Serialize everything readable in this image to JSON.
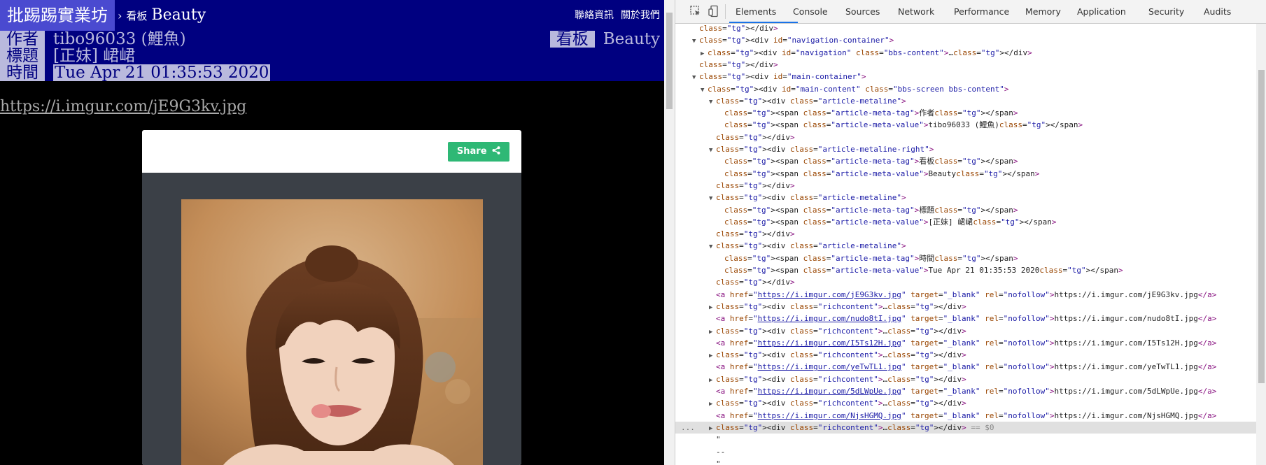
{
  "topbar": {
    "brand": "批踢踢實業坊",
    "separator": "›",
    "board_prefix": "看板",
    "board_name": "Beauty",
    "links": [
      "聯絡資訊",
      "關於我們"
    ]
  },
  "meta": {
    "author_tag": "作者",
    "author_value": "tibo96033 (鯉魚)",
    "board_tag": "看板",
    "board_value": "Beauty",
    "title_tag": "標題",
    "title_value": "[正妹] 峮峮",
    "time_tag": "時間",
    "time_value": "Tue Apr 21 01:35:53 2020"
  },
  "article": {
    "image_link": "https://i.imgur.com/jE9G3kv.jpg",
    "share_label": "Share"
  },
  "devtools": {
    "tabs": [
      "Elements",
      "Console",
      "Sources",
      "Network",
      "Performance",
      "Memory",
      "Application",
      "Security",
      "Audits"
    ],
    "active_tab": "Elements",
    "tree": [
      {
        "indent": 1,
        "tri": "",
        "html": "</div>"
      },
      {
        "indent": 1,
        "tri": "▼",
        "html": "<div id=\"navigation-container\">"
      },
      {
        "indent": 2,
        "tri": "▶",
        "html": "<div id=\"navigation\" class=\"bbs-content\">…</div>"
      },
      {
        "indent": 1,
        "tri": "",
        "html": "</div>"
      },
      {
        "indent": 1,
        "tri": "▼",
        "html": "<div id=\"main-container\">"
      },
      {
        "indent": 2,
        "tri": "▼",
        "html": "<div id=\"main-content\" class=\"bbs-screen bbs-content\">"
      },
      {
        "indent": 3,
        "tri": "▼",
        "html": "<div class=\"article-metaline\">"
      },
      {
        "indent": 4,
        "tri": "",
        "html": "<span class=\"article-meta-tag\">作者</span>"
      },
      {
        "indent": 4,
        "tri": "",
        "html": "<span class=\"article-meta-value\">tibo96033 (鯉魚)</span>"
      },
      {
        "indent": 3,
        "tri": "",
        "html": "</div>"
      },
      {
        "indent": 3,
        "tri": "▼",
        "html": "<div class=\"article-metaline-right\">"
      },
      {
        "indent": 4,
        "tri": "",
        "html": "<span class=\"article-meta-tag\">看板</span>"
      },
      {
        "indent": 4,
        "tri": "",
        "html": "<span class=\"article-meta-value\">Beauty</span>"
      },
      {
        "indent": 3,
        "tri": "",
        "html": "</div>"
      },
      {
        "indent": 3,
        "tri": "▼",
        "html": "<div class=\"article-metaline\">"
      },
      {
        "indent": 4,
        "tri": "",
        "html": "<span class=\"article-meta-tag\">標題</span>"
      },
      {
        "indent": 4,
        "tri": "",
        "html": "<span class=\"article-meta-value\">[正妹] 峮峮</span>"
      },
      {
        "indent": 3,
        "tri": "",
        "html": "</div>"
      },
      {
        "indent": 3,
        "tri": "▼",
        "html": "<div class=\"article-metaline\">"
      },
      {
        "indent": 4,
        "tri": "",
        "html": "<span class=\"article-meta-tag\">時間</span>"
      },
      {
        "indent": 4,
        "tri": "",
        "html": "<span class=\"article-meta-value\">Tue Apr 21 01:35:53 2020</span>"
      },
      {
        "indent": 3,
        "tri": "",
        "html": "</div>"
      },
      {
        "indent": 3,
        "tri": "",
        "link": "https://i.imgur.com/jE9G3kv.jpg"
      },
      {
        "indent": 3,
        "tri": "▶",
        "html": "<div class=\"richcontent\">…</div>"
      },
      {
        "indent": 3,
        "tri": "",
        "link": "https://i.imgur.com/nudo8tI.jpg"
      },
      {
        "indent": 3,
        "tri": "▶",
        "html": "<div class=\"richcontent\">…</div>"
      },
      {
        "indent": 3,
        "tri": "",
        "link": "https://i.imgur.com/I5Ts12H.jpg"
      },
      {
        "indent": 3,
        "tri": "▶",
        "html": "<div class=\"richcontent\">…</div>"
      },
      {
        "indent": 3,
        "tri": "",
        "link": "https://i.imgur.com/yeTwTL1.jpg"
      },
      {
        "indent": 3,
        "tri": "▶",
        "html": "<div class=\"richcontent\">…</div>"
      },
      {
        "indent": 3,
        "tri": "",
        "link": "https://i.imgur.com/5dLWpUe.jpg"
      },
      {
        "indent": 3,
        "tri": "▶",
        "html": "<div class=\"richcontent\">…</div>"
      },
      {
        "indent": 3,
        "tri": "",
        "link": "https://i.imgur.com/NjsHGMQ.jpg"
      },
      {
        "indent": 3,
        "tri": "▶",
        "html": "<div class=\"richcontent\">…</div> == $0",
        "selected": true
      },
      {
        "indent": 3,
        "tri": "",
        "html": "\""
      },
      {
        "indent": 3,
        "tri": "",
        "html": "--"
      },
      {
        "indent": 3,
        "tri": "",
        "html": "\""
      }
    ],
    "row_ellipsis": "..."
  }
}
